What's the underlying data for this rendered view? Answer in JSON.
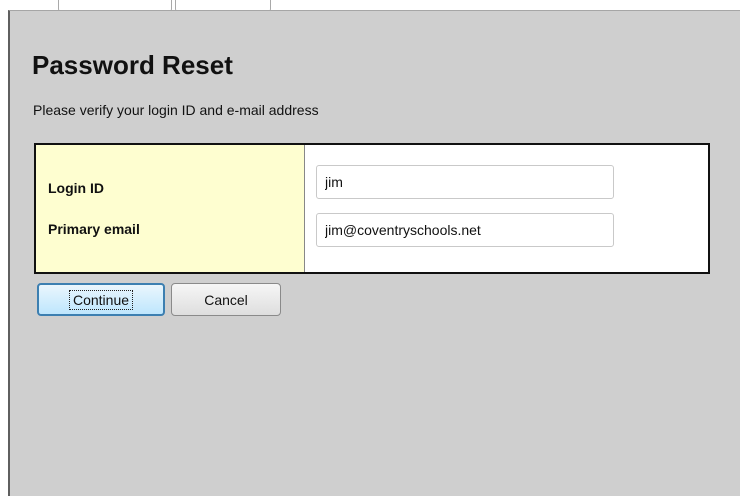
{
  "page": {
    "title": "Password Reset",
    "subtitle": "Please verify your login ID and e-mail address"
  },
  "form": {
    "login_label": "Login ID",
    "login_value": "jim",
    "email_label": "Primary email",
    "email_value": "jim@coventryschools.net"
  },
  "buttons": {
    "continue_label": "Continue",
    "cancel_label": "Cancel"
  },
  "colors": {
    "panel_background": "#cfcfcf",
    "label_column_background": "#fefed0",
    "focused_button_border": "#3c7fb1"
  }
}
